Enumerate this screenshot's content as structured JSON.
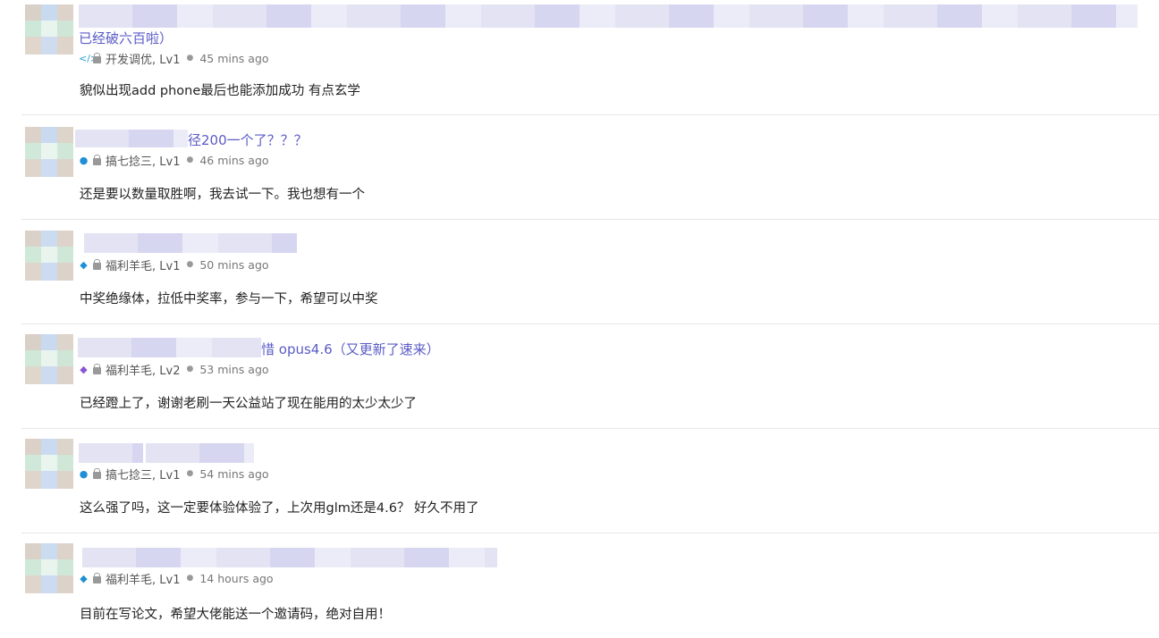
{
  "feed": [
    {
      "title_visible": "已经破六百啦）",
      "category_icon": "code-icon",
      "category_icon_color": "#2aa0d8",
      "category": "开发调优, Lv1",
      "time": "45 mins ago",
      "excerpt": "貌似出现add phone最后也能添加成功 有点玄学"
    },
    {
      "title_visible": "径200一个了？？？",
      "category_icon": "droplet-icon",
      "category_icon_color": "#1f8fd6",
      "category": "搞七捻三, Lv1",
      "time": "46 mins ago",
      "excerpt": "还是要以数量取胜啊，我去试一下。我也想有一个"
    },
    {
      "title_visible": "",
      "category_icon": "piggy-icon",
      "category_icon_color": "#1f8fd6",
      "category": "福利羊毛, Lv1",
      "time": "50 mins ago",
      "excerpt": "中奖绝缘体，拉低中奖率，参与一下，希望可以中奖"
    },
    {
      "title_visible": "惜 opus4.6（又更新了速来）",
      "category_icon": "piggy-icon",
      "category_icon_color": "#8a56d6",
      "category": "福利羊毛, Lv2",
      "time": "53 mins ago",
      "excerpt": "已经蹬上了，谢谢老刷一天公益站了现在能用的太少太少了"
    },
    {
      "title_visible": "",
      "category_icon": "droplet-icon",
      "category_icon_color": "#1f8fd6",
      "category": "搞七捻三, Lv1",
      "time": "54 mins ago",
      "excerpt": "这么强了吗，这一定要体验体验了，上次用glm还是4.6？ 好久不用了"
    },
    {
      "title_visible": "",
      "category_icon": "piggy-icon",
      "category_icon_color": "#1f8fd6",
      "category": "福利羊毛, Lv1",
      "time": "14 hours ago",
      "excerpt": "目前在写论文，希望大佬能送一个邀请码，绝对自用！"
    }
  ]
}
